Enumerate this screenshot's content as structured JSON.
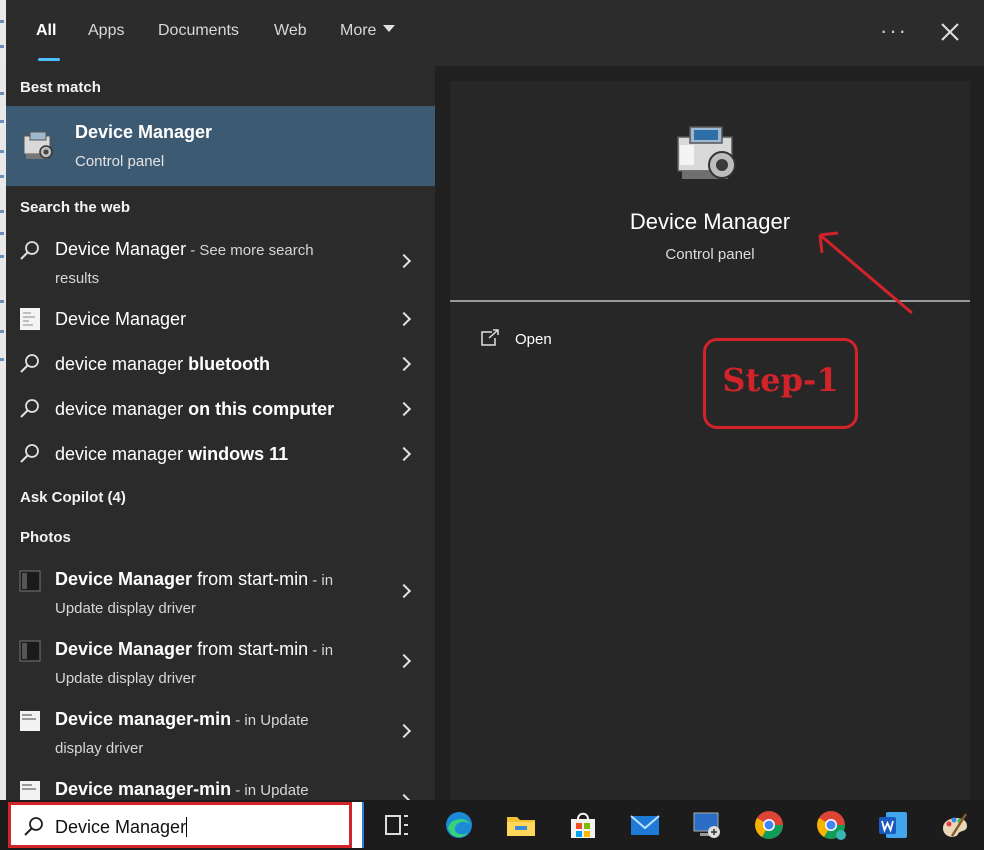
{
  "tabs": [
    {
      "label": "All"
    },
    {
      "label": "Apps"
    },
    {
      "label": "Documents"
    },
    {
      "label": "Web"
    },
    {
      "label": "More"
    }
  ],
  "sections": {
    "best_match": "Best match",
    "search_web": "Search the web",
    "ask_copilot": "Ask Copilot (4)",
    "photos": "Photos"
  },
  "best_match": {
    "title": "Device Manager",
    "subtitle": "Control panel"
  },
  "web_results": [
    {
      "main": "Device Manager",
      "suffix": " - See more search",
      "line2": "results"
    },
    {
      "main": "Device Manager"
    },
    {
      "prefix": "device manager ",
      "bold": "bluetooth"
    },
    {
      "prefix": "device manager ",
      "bold": "on this computer"
    },
    {
      "prefix": "device manager ",
      "bold": "windows 11"
    }
  ],
  "photo_results": [
    {
      "bold": "Device Manager",
      "rest": " from start-min",
      "small": " - in",
      "line2": "Update display driver"
    },
    {
      "bold": "Device Manager",
      "rest": " from start-min",
      "small": " - in",
      "line2": "Update display driver"
    },
    {
      "bold": "Device manager-min",
      "small": " - in Update",
      "line2": "display driver"
    },
    {
      "bold": "Device manager-min",
      "small": " - in Update",
      "line2": ""
    }
  ],
  "preview": {
    "title": "Device Manager",
    "subtitle": "Control panel",
    "open_label": "Open"
  },
  "annotation": {
    "step_label": "Step-1"
  },
  "search": {
    "value": "Device Manager"
  },
  "taskbar_icons": [
    "task-view-icon",
    "edge-icon",
    "file-explorer-icon",
    "store-icon",
    "mail-icon",
    "remote-desktop-icon",
    "chrome-icon",
    "chrome-profile-icon",
    "word-icon",
    "paint-icon"
  ],
  "colors": {
    "accent": "#4cc2ff",
    "selected": "#3d5a73",
    "annotation": "#d2232a"
  }
}
